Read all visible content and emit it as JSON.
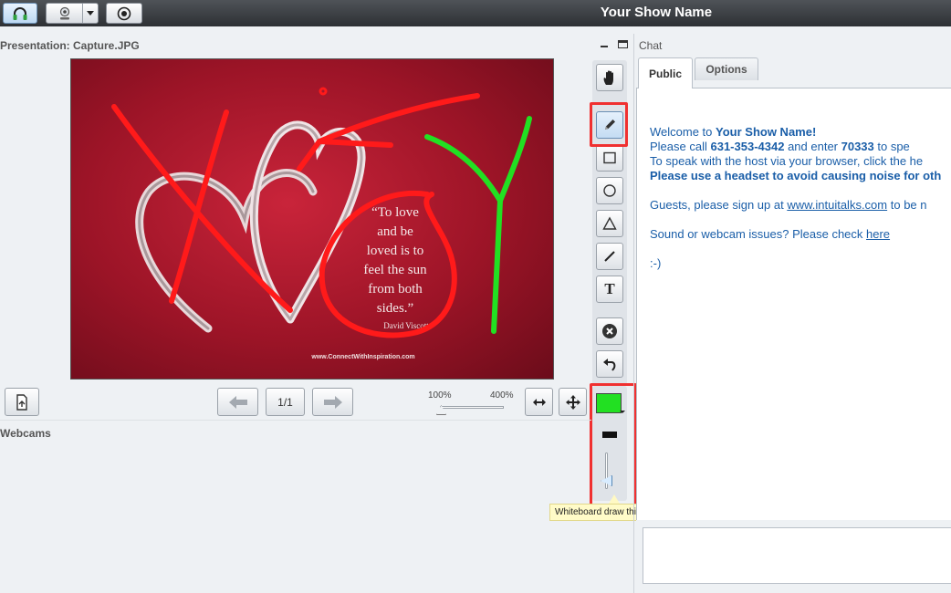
{
  "header": {
    "show_name": "Your Show Name"
  },
  "presentation": {
    "title": "Presentation: Capture.JPG",
    "slide": {
      "quote_lines": [
        "“To love",
        "and be",
        "loved is to",
        "feel the sun",
        "from both",
        "sides.”"
      ],
      "quote_author": "David Viscott",
      "footer_url": "www.ConnectWithInspiration.com"
    },
    "page_indicator": "1/1",
    "zoom_min": "100%",
    "zoom_max": "400%",
    "zoom_value": 0.0
  },
  "whiteboard": {
    "tools": [
      "hand-icon",
      "pencil-icon",
      "rectangle-icon",
      "ellipse-icon",
      "triangle-icon",
      "line-icon",
      "text-icon",
      "clear-icon",
      "undo-icon"
    ],
    "selected_tool": "pencil-icon",
    "text_tool_glyph": "T",
    "color": "#22dd22",
    "thickness_tooltip": "Whiteboard draw thickness",
    "thickness_level": 0.15
  },
  "webcams": {
    "title": "Webcams"
  },
  "chat": {
    "title": "Chat",
    "tabs": [
      "Public",
      "Options"
    ],
    "active_tab": "Public",
    "welcome_prefix": "Welcome to ",
    "welcome_bold": "Your Show Name!",
    "call_prefix": " Please call ",
    "phone": "631-353-4342",
    "call_mid": " and enter ",
    "pin": "70333",
    "call_suffix": " to spe",
    "browser_line": "To speak with the host via your browser, click the he",
    "headset_line": "Please use a headset to avoid causing noise for oth",
    "guests_prefix": "Guests, please sign up at ",
    "guests_link": "www.intuitalks.com",
    "guests_suffix": " to be n",
    "issues_prefix": "Sound or webcam issues? Please check ",
    "issues_link": "here",
    "smiley": ":-)",
    "input_value": ""
  }
}
